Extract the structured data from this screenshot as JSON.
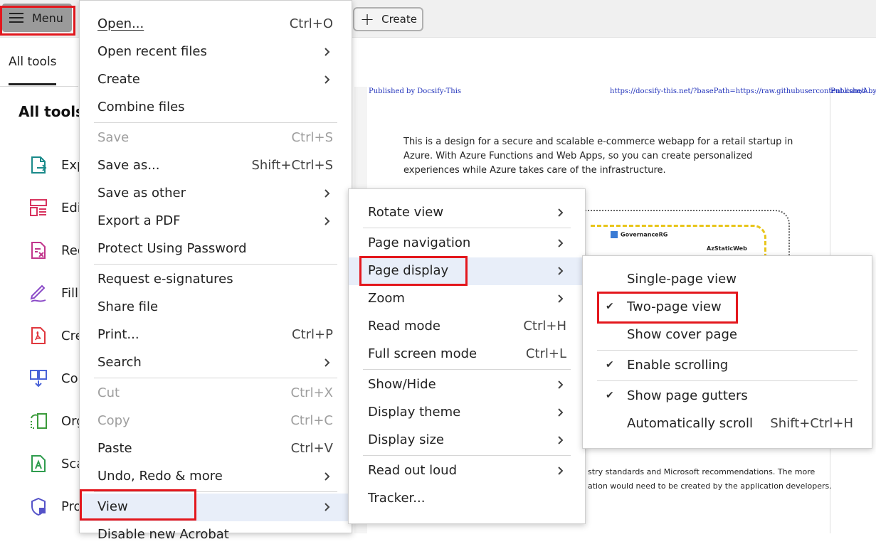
{
  "topbar": {
    "menu_label": "Menu",
    "create_label": "Create"
  },
  "left": {
    "tab": "All tools",
    "heading": "All tools",
    "tools": [
      {
        "label": "Exp",
        "icon": "export-pdf-icon",
        "color": "#1a8a8a"
      },
      {
        "label": "Edi",
        "icon": "edit-pdf-icon",
        "color": "#d8345f"
      },
      {
        "label": "Rec",
        "icon": "redact-icon",
        "color": "#c1358c"
      },
      {
        "label": "Fill",
        "icon": "fill-sign-icon",
        "color": "#8a49c7"
      },
      {
        "label": "Cre",
        "icon": "create-pdf-icon",
        "color": "#e0383e"
      },
      {
        "label": "Co",
        "icon": "combine-files-icon",
        "color": "#4a63d8"
      },
      {
        "label": "Org",
        "icon": "organize-pages-icon",
        "color": "#3b9b3b"
      },
      {
        "label": "Sca",
        "icon": "scan-ocr-icon",
        "color": "#2f9c4e"
      },
      {
        "label": "Pro",
        "icon": "protect-icon",
        "color": "#5452c8"
      }
    ]
  },
  "document": {
    "header_left": "Published by Docsify-This",
    "header_right": "https://docsify-this.net/?basePath=https://raw.githubusercontent.com/A...",
    "header_page2": "Published by D",
    "paragraph": "This is a design for a secure and scalable e-commerce webapp for a retail startup in Azure. With Azure Functions and Web Apps, so you can create personalized experiences while Azure takes care of the infrastructure.",
    "diagram_label_1": "GovernanceRG",
    "diagram_label_2": "AzStaticWeb",
    "bottom_line_1": "stry standards and Microsoft recommendations. The more",
    "bottom_line_2": "ation would need to be created by the application developers."
  },
  "main_menu": {
    "items": [
      {
        "label": "Open...",
        "shortcut": "Ctrl+O"
      },
      {
        "label": "Open recent files",
        "submenu": true
      },
      {
        "label": "Create",
        "submenu": true
      },
      {
        "label": "Combine files"
      },
      {
        "label": "Save",
        "shortcut": "Ctrl+S",
        "disabled": true
      },
      {
        "label": "Save as...",
        "shortcut": "Shift+Ctrl+S"
      },
      {
        "label": "Save as other",
        "submenu": true
      },
      {
        "label": "Export a PDF",
        "submenu": true
      },
      {
        "label": "Protect Using Password"
      },
      {
        "label": "Request e-signatures"
      },
      {
        "label": "Share file"
      },
      {
        "label": "Print...",
        "shortcut": "Ctrl+P"
      },
      {
        "label": "Search",
        "submenu": true
      },
      {
        "label": "Cut",
        "shortcut": "Ctrl+X",
        "disabled": true
      },
      {
        "label": "Copy",
        "shortcut": "Ctrl+C",
        "disabled": true
      },
      {
        "label": "Paste",
        "shortcut": "Ctrl+V"
      },
      {
        "label": "Undo, Redo & more",
        "submenu": true
      },
      {
        "label": "View",
        "submenu": true,
        "highlighted": true
      },
      {
        "label": "Disable new Acrobat"
      }
    ]
  },
  "view_menu": {
    "items": [
      {
        "label": "Rotate view",
        "submenu": true
      },
      {
        "label": "Page navigation",
        "submenu": true
      },
      {
        "label": "Page display",
        "submenu": true,
        "highlighted": true
      },
      {
        "label": "Zoom",
        "submenu": true
      },
      {
        "label": "Read mode",
        "shortcut": "Ctrl+H"
      },
      {
        "label": "Full screen mode",
        "shortcut": "Ctrl+L"
      },
      {
        "label": "Show/Hide",
        "submenu": true
      },
      {
        "label": "Display theme",
        "submenu": true
      },
      {
        "label": "Display size",
        "submenu": true
      },
      {
        "label": "Read out loud",
        "submenu": true
      },
      {
        "label": "Tracker..."
      }
    ]
  },
  "page_display_menu": {
    "items": [
      {
        "label": "Single-page view",
        "checked": false
      },
      {
        "label": "Two-page view",
        "checked": true
      },
      {
        "label": "Show cover page",
        "checked": false
      },
      {
        "label": "Enable scrolling",
        "checked": true
      },
      {
        "label": "Show page gutters",
        "checked": true
      },
      {
        "label": "Automatically scroll",
        "shortcut": "Shift+Ctrl+H",
        "checked": false
      }
    ]
  },
  "colors": {
    "highlight_box": "#e3171d",
    "menu_hover": "#e8eef9"
  }
}
